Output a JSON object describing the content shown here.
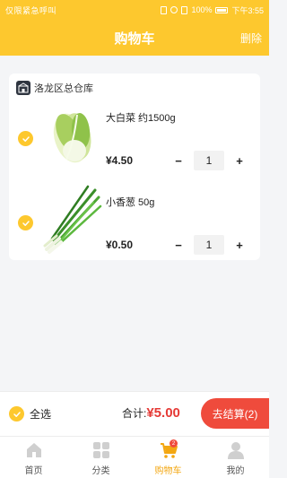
{
  "status_bar": {
    "left_text": "仅限紧急呼叫",
    "battery": "100%",
    "time": "下午3:55"
  },
  "header": {
    "title": "购物车",
    "delete_label": "删除"
  },
  "store": {
    "name": "洛龙区总仓库",
    "icon": "store-icon"
  },
  "items": [
    {
      "name": "大白菜 约1500g",
      "price": "¥4.50",
      "quantity": "1",
      "minus": "−",
      "plus": "+",
      "image": "napa-cabbage"
    },
    {
      "name": "小香葱 50g",
      "price": "¥0.50",
      "quantity": "1",
      "minus": "−",
      "plus": "+",
      "image": "green-onion"
    }
  ],
  "action_bar": {
    "select_all_label": "全选",
    "total_label": "合计:",
    "total_value": "¥5.00",
    "checkout_label": "去结算(2)"
  },
  "tabbar": {
    "tabs": [
      {
        "label": "首页",
        "icon": "home-icon",
        "active": false
      },
      {
        "label": "分类",
        "icon": "category-icon",
        "active": false
      },
      {
        "label": "购物车",
        "icon": "cart-icon",
        "active": true,
        "badge": "2"
      },
      {
        "label": "我的",
        "icon": "profile-icon",
        "active": false
      }
    ]
  },
  "colors": {
    "brand": "#fdc82e",
    "checkout": "#ef4b3c",
    "price_total": "#e53935"
  }
}
